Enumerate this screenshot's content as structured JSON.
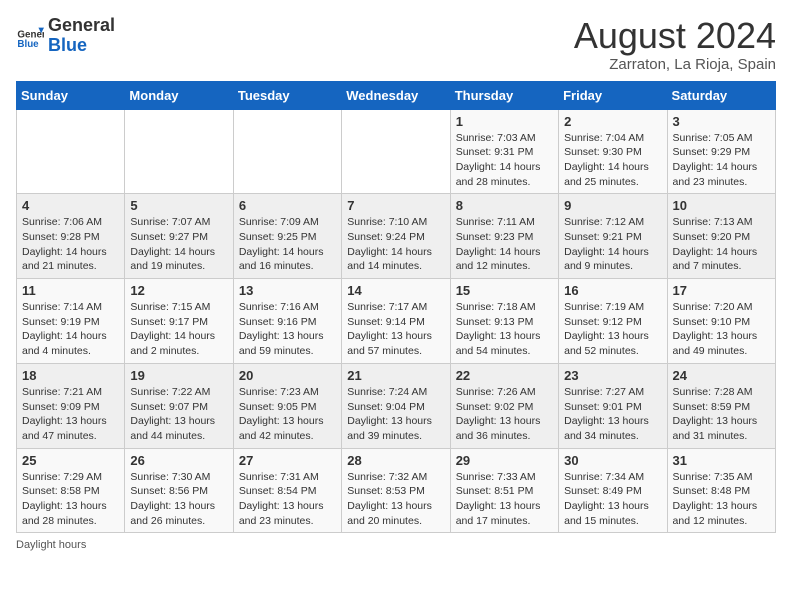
{
  "header": {
    "logo_general": "General",
    "logo_blue": "Blue",
    "month_year": "August 2024",
    "location": "Zarraton, La Rioja, Spain"
  },
  "days_of_week": [
    "Sunday",
    "Monday",
    "Tuesday",
    "Wednesday",
    "Thursday",
    "Friday",
    "Saturday"
  ],
  "weeks": [
    [
      {
        "day": "",
        "info": ""
      },
      {
        "day": "",
        "info": ""
      },
      {
        "day": "",
        "info": ""
      },
      {
        "day": "",
        "info": ""
      },
      {
        "day": "1",
        "info": "Sunrise: 7:03 AM\nSunset: 9:31 PM\nDaylight: 14 hours\nand 28 minutes."
      },
      {
        "day": "2",
        "info": "Sunrise: 7:04 AM\nSunset: 9:30 PM\nDaylight: 14 hours\nand 25 minutes."
      },
      {
        "day": "3",
        "info": "Sunrise: 7:05 AM\nSunset: 9:29 PM\nDaylight: 14 hours\nand 23 minutes."
      }
    ],
    [
      {
        "day": "4",
        "info": "Sunrise: 7:06 AM\nSunset: 9:28 PM\nDaylight: 14 hours\nand 21 minutes."
      },
      {
        "day": "5",
        "info": "Sunrise: 7:07 AM\nSunset: 9:27 PM\nDaylight: 14 hours\nand 19 minutes."
      },
      {
        "day": "6",
        "info": "Sunrise: 7:09 AM\nSunset: 9:25 PM\nDaylight: 14 hours\nand 16 minutes."
      },
      {
        "day": "7",
        "info": "Sunrise: 7:10 AM\nSunset: 9:24 PM\nDaylight: 14 hours\nand 14 minutes."
      },
      {
        "day": "8",
        "info": "Sunrise: 7:11 AM\nSunset: 9:23 PM\nDaylight: 14 hours\nand 12 minutes."
      },
      {
        "day": "9",
        "info": "Sunrise: 7:12 AM\nSunset: 9:21 PM\nDaylight: 14 hours\nand 9 minutes."
      },
      {
        "day": "10",
        "info": "Sunrise: 7:13 AM\nSunset: 9:20 PM\nDaylight: 14 hours\nand 7 minutes."
      }
    ],
    [
      {
        "day": "11",
        "info": "Sunrise: 7:14 AM\nSunset: 9:19 PM\nDaylight: 14 hours\nand 4 minutes."
      },
      {
        "day": "12",
        "info": "Sunrise: 7:15 AM\nSunset: 9:17 PM\nDaylight: 14 hours\nand 2 minutes."
      },
      {
        "day": "13",
        "info": "Sunrise: 7:16 AM\nSunset: 9:16 PM\nDaylight: 13 hours\nand 59 minutes."
      },
      {
        "day": "14",
        "info": "Sunrise: 7:17 AM\nSunset: 9:14 PM\nDaylight: 13 hours\nand 57 minutes."
      },
      {
        "day": "15",
        "info": "Sunrise: 7:18 AM\nSunset: 9:13 PM\nDaylight: 13 hours\nand 54 minutes."
      },
      {
        "day": "16",
        "info": "Sunrise: 7:19 AM\nSunset: 9:12 PM\nDaylight: 13 hours\nand 52 minutes."
      },
      {
        "day": "17",
        "info": "Sunrise: 7:20 AM\nSunset: 9:10 PM\nDaylight: 13 hours\nand 49 minutes."
      }
    ],
    [
      {
        "day": "18",
        "info": "Sunrise: 7:21 AM\nSunset: 9:09 PM\nDaylight: 13 hours\nand 47 minutes."
      },
      {
        "day": "19",
        "info": "Sunrise: 7:22 AM\nSunset: 9:07 PM\nDaylight: 13 hours\nand 44 minutes."
      },
      {
        "day": "20",
        "info": "Sunrise: 7:23 AM\nSunset: 9:05 PM\nDaylight: 13 hours\nand 42 minutes."
      },
      {
        "day": "21",
        "info": "Sunrise: 7:24 AM\nSunset: 9:04 PM\nDaylight: 13 hours\nand 39 minutes."
      },
      {
        "day": "22",
        "info": "Sunrise: 7:26 AM\nSunset: 9:02 PM\nDaylight: 13 hours\nand 36 minutes."
      },
      {
        "day": "23",
        "info": "Sunrise: 7:27 AM\nSunset: 9:01 PM\nDaylight: 13 hours\nand 34 minutes."
      },
      {
        "day": "24",
        "info": "Sunrise: 7:28 AM\nSunset: 8:59 PM\nDaylight: 13 hours\nand 31 minutes."
      }
    ],
    [
      {
        "day": "25",
        "info": "Sunrise: 7:29 AM\nSunset: 8:58 PM\nDaylight: 13 hours\nand 28 minutes."
      },
      {
        "day": "26",
        "info": "Sunrise: 7:30 AM\nSunset: 8:56 PM\nDaylight: 13 hours\nand 26 minutes."
      },
      {
        "day": "27",
        "info": "Sunrise: 7:31 AM\nSunset: 8:54 PM\nDaylight: 13 hours\nand 23 minutes."
      },
      {
        "day": "28",
        "info": "Sunrise: 7:32 AM\nSunset: 8:53 PM\nDaylight: 13 hours\nand 20 minutes."
      },
      {
        "day": "29",
        "info": "Sunrise: 7:33 AM\nSunset: 8:51 PM\nDaylight: 13 hours\nand 17 minutes."
      },
      {
        "day": "30",
        "info": "Sunrise: 7:34 AM\nSunset: 8:49 PM\nDaylight: 13 hours\nand 15 minutes."
      },
      {
        "day": "31",
        "info": "Sunrise: 7:35 AM\nSunset: 8:48 PM\nDaylight: 13 hours\nand 12 minutes."
      }
    ]
  ],
  "footer": {
    "daylight_label": "Daylight hours"
  }
}
